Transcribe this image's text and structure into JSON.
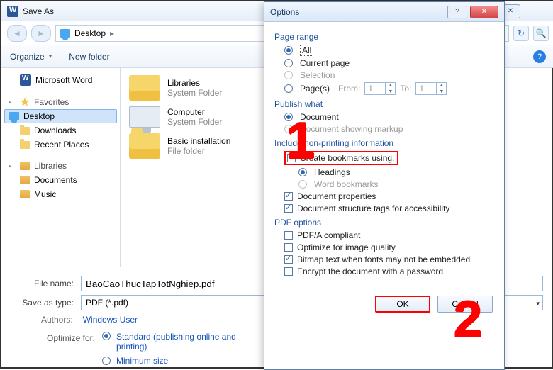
{
  "saveAs": {
    "title": "Save As",
    "breadcrumb": {
      "location": "Desktop"
    },
    "toolbar": {
      "organize": "Organize",
      "newFolder": "New folder"
    },
    "sidebar": {
      "msWord": "Microsoft Word",
      "favHeader": "Favorites",
      "favItems": [
        "Desktop",
        "Downloads",
        "Recent Places"
      ],
      "libHeader": "Libraries",
      "libItems": [
        "Documents",
        "Music"
      ]
    },
    "list": [
      {
        "name": "Libraries",
        "sub": "System Folder"
      },
      {
        "name": "Computer",
        "sub": "System Folder"
      },
      {
        "name": "Basic installation",
        "sub": "File folder"
      }
    ],
    "fileNameLabel": "File name:",
    "fileName": "BaoCaoThucTapTotNghiep.pdf",
    "saveTypeLabel": "Save as type:",
    "saveType": "PDF (*.pdf)",
    "authorsLabel": "Authors:",
    "authorsValue": "Windows User",
    "optimizeLabel": "Optimize for:",
    "optimizeStandard": "Standard (publishing online and printing)",
    "optimizeMin": "Minimum size"
  },
  "options": {
    "title": "Options",
    "pageRange": {
      "label": "Page range",
      "all": "All",
      "current": "Current page",
      "selection": "Selection",
      "pages": "Page(s)",
      "fromLabel": "From:",
      "fromVal": "1",
      "toLabel": "To:",
      "toVal": "1"
    },
    "publish": {
      "label": "Publish what",
      "doc": "Document",
      "markup": "Document showing markup"
    },
    "nonprint": {
      "label": "Include non-printing information",
      "createBookmarks": "Create bookmarks using:",
      "headings": "Headings",
      "wordBookmarks": "Word bookmarks",
      "docProps": "Document properties",
      "structTags": "Document structure tags for accessibility"
    },
    "pdf": {
      "label": "PDF options",
      "pdfa": "PDF/A compliant",
      "optimizeImg": "Optimize for image quality",
      "bitmap": "Bitmap text when fonts may not be embedded",
      "encrypt": "Encrypt the document with a password"
    },
    "buttons": {
      "ok": "OK",
      "cancel": "Cancel"
    }
  },
  "annotations": {
    "one": "1",
    "two": "2"
  }
}
